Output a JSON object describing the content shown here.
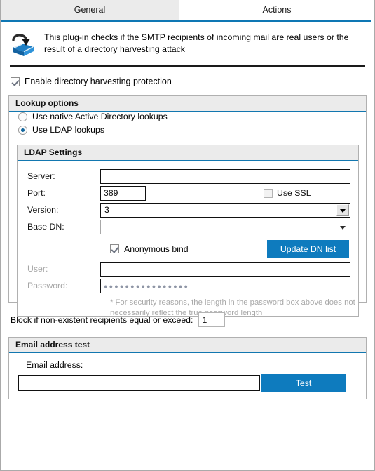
{
  "tabs": [
    {
      "label": "General",
      "active": false
    },
    {
      "label": "Actions",
      "active": true
    }
  ],
  "header": {
    "icon": "directory-book-icon",
    "description": "This plug-in checks if the SMTP recipients of incoming mail are real users or the result of a directory harvesting attack"
  },
  "enable": {
    "label": "Enable directory harvesting protection",
    "checked": true
  },
  "lookup_options": {
    "title": "Lookup options",
    "radios": [
      {
        "label": "Use native Active Directory lookups",
        "selected": false
      },
      {
        "label": "Use LDAP lookups",
        "selected": true
      }
    ],
    "ldap": {
      "title": "LDAP Settings",
      "server": {
        "label": "Server:",
        "value": ""
      },
      "port": {
        "label": "Port:",
        "value": "389"
      },
      "use_ssl": {
        "label": "Use SSL",
        "checked": false,
        "enabled": false
      },
      "version": {
        "label": "Version:",
        "value": "3"
      },
      "base_dn": {
        "label": "Base DN:",
        "value": ""
      },
      "anonymous_bind": {
        "label": "Anonymous bind",
        "checked": true
      },
      "update_dn_button": "Update DN list",
      "user": {
        "label": "User:",
        "value": "",
        "enabled": false
      },
      "password": {
        "label": "Password:",
        "value": "●●●●●●●●●●●●●●●●",
        "enabled": false
      },
      "note": "* For security reasons, the length in the password box above does not necessarily reflect the true password length"
    }
  },
  "block_rule": {
    "label": "Block if non-existent recipients equal or exceed:",
    "value": "1"
  },
  "email_test": {
    "title": "Email address test",
    "address_label": "Email address:",
    "address_value": "",
    "test_button": "Test"
  },
  "colors": {
    "accent": "#0e7bbe",
    "tab_underline": "#0e77b4",
    "group_header_bg": "#ebebeb",
    "group_header_rule": "#1277b0",
    "disabled_text": "#a6a6a6"
  }
}
